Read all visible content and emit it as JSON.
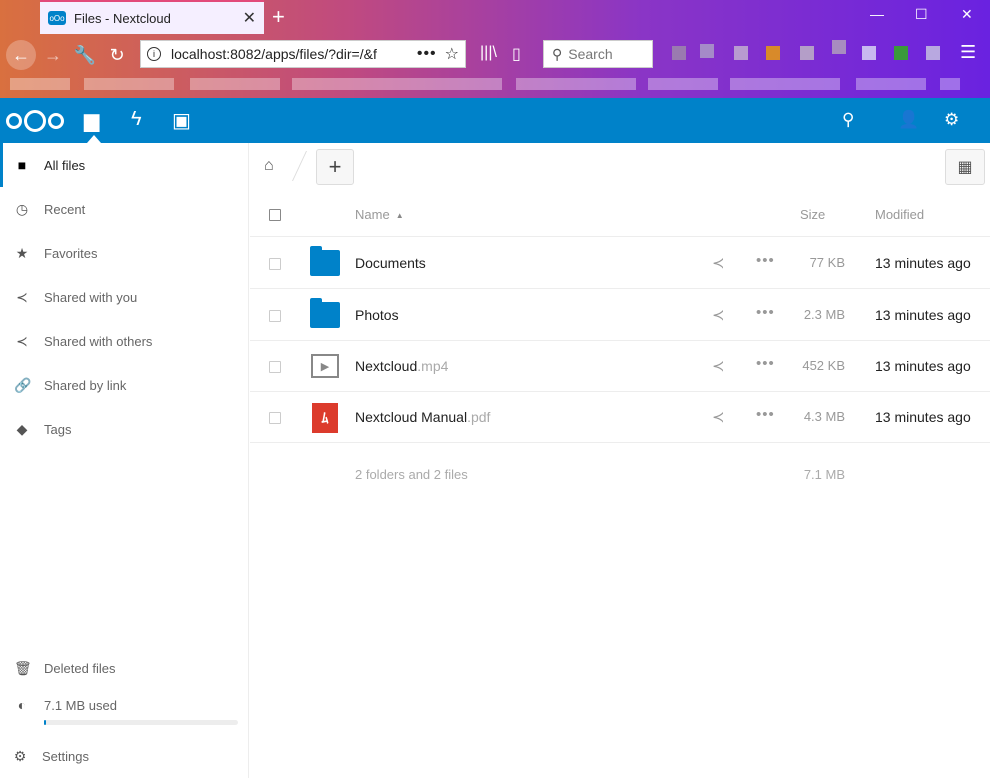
{
  "browser": {
    "tab_title": "Files - Nextcloud",
    "new_tab": "+",
    "url": "localhost:8082/apps/files/?dir=/&f",
    "search_placeholder": "Search"
  },
  "nc": {
    "apps": [
      {
        "name": "files",
        "icon": "folder-icon"
      },
      {
        "name": "activity",
        "icon": "lightning-icon"
      },
      {
        "name": "gallery",
        "icon": "image-icon"
      }
    ],
    "header_icons": [
      "search-icon",
      "contacts-icon",
      "settings-gear-icon"
    ]
  },
  "sidebar": {
    "items": [
      {
        "label": "All files",
        "icon": "folder-icon",
        "active": true
      },
      {
        "label": "Recent",
        "icon": "clock-icon"
      },
      {
        "label": "Favorites",
        "icon": "star-icon"
      },
      {
        "label": "Shared with you",
        "icon": "share-icon"
      },
      {
        "label": "Shared with others",
        "icon": "share-icon"
      },
      {
        "label": "Shared by link",
        "icon": "link-icon"
      },
      {
        "label": "Tags",
        "icon": "tag-icon"
      }
    ],
    "deleted_files": "Deleted files",
    "quota": "7.1 MB used",
    "quota_fraction": 0.01,
    "settings": "Settings"
  },
  "files": {
    "columns": {
      "name": "Name",
      "size": "Size",
      "modified": "Modified"
    },
    "rows": [
      {
        "name": "Documents",
        "ext": "",
        "type": "folder",
        "size": "77 KB",
        "modified": "13 minutes ago"
      },
      {
        "name": "Photos",
        "ext": "",
        "type": "folder",
        "size": "2.3 MB",
        "modified": "13 minutes ago"
      },
      {
        "name": "Nextcloud",
        "ext": ".mp4",
        "type": "video",
        "size": "452 KB",
        "modified": "13 minutes ago"
      },
      {
        "name": "Nextcloud Manual",
        "ext": ".pdf",
        "type": "pdf",
        "size": "4.3 MB",
        "modified": "13 minutes ago"
      }
    ],
    "summary": "2 folders and 2 files",
    "summary_size": "7.1 MB"
  },
  "colors": {
    "brand": "#0082c9",
    "pdf": "#dc3b2c"
  }
}
